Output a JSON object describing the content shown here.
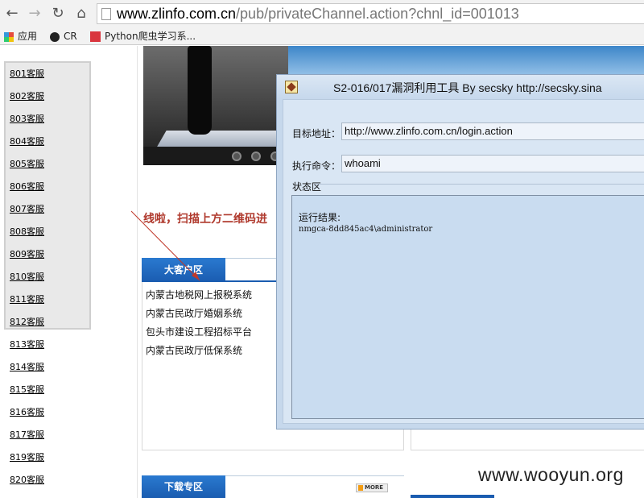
{
  "browser": {
    "url_domain": "www.zlinfo.com.cn",
    "url_path": "/pub/privateChannel.action?chnl_id=001013",
    "bookmarks": [
      {
        "label": "应用",
        "icon": "apps-grid-icon"
      },
      {
        "label": "CR",
        "icon": "cr-icon"
      },
      {
        "label": "Python爬虫学习系...",
        "icon": "bookmark-site-icon"
      }
    ],
    "nav_icons": [
      "back-icon",
      "forward-icon",
      "reload-icon",
      "home-icon"
    ]
  },
  "leftnav": {
    "items": [
      "801客服",
      "802客服",
      "803客服",
      "804客服",
      "805客服",
      "806客服",
      "807客服",
      "808客服",
      "809客服",
      "810客服",
      "811客服",
      "812客服",
      "813客服",
      "814客服",
      "815客服",
      "816客服",
      "817客服",
      "819客服",
      "820客服"
    ]
  },
  "page": {
    "scan_text": "线啦，扫描上方二维码进",
    "big_customer_tab": "大客户区",
    "customer_list": [
      "内蒙古地税网上报税系统",
      "内蒙古民政厅婚姻系统",
      "包头市建设工程招标平台",
      "内蒙古民政厅低保系统"
    ],
    "download_tab": "下载专区",
    "more_label": "MORE"
  },
  "dialog": {
    "title": "S2-016/017漏洞利用工具  By secsky     http://secsky.sina",
    "target_label": "目标地址：",
    "target_value": "http://www.zlinfo.com.cn/login.action",
    "command_label": "执行命令：",
    "command_value": "whoami",
    "status_label": "状态区",
    "result_label": "运行结果:",
    "result_value": "nmgca-8dd845ac4\\administrator"
  },
  "watermark": "www.wooyun.org",
  "colors": {
    "accent_blue": "#1a5cb0",
    "scan_text_red": "#b03a2e",
    "dialog_bg": "#c6d8ec"
  }
}
